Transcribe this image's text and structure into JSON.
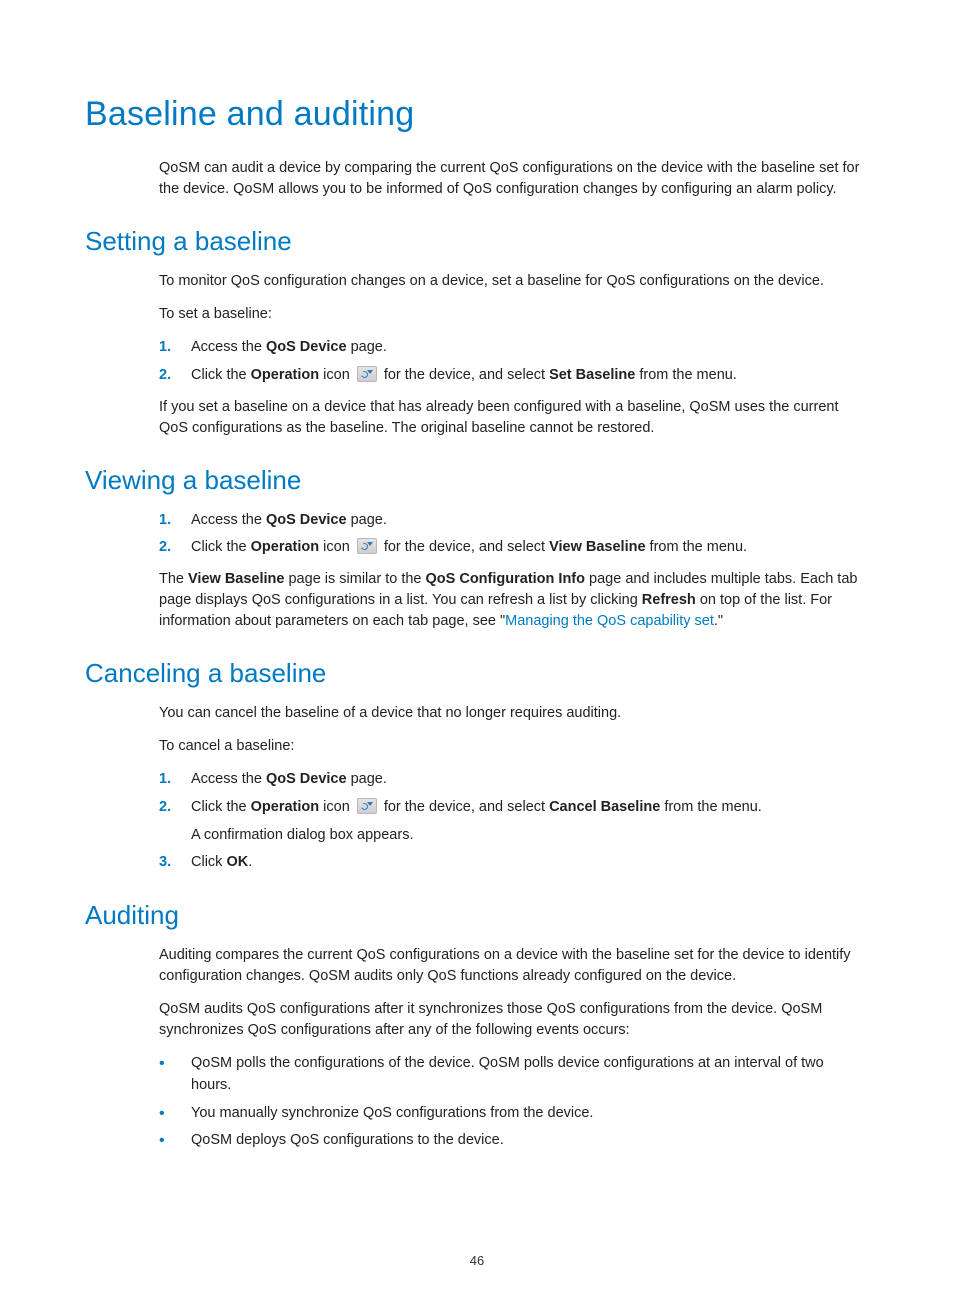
{
  "title": "Baseline and auditing",
  "intro": "QoSM can audit a device by comparing the current QoS configurations on the device with the baseline set for the device. QoSM allows you to be informed of QoS configuration changes by configuring an alarm policy.",
  "setting": {
    "heading": "Setting a baseline",
    "p1": "To monitor QoS configuration changes on a device, set a baseline for QoS configurations on the device.",
    "p2": "To set a baseline:",
    "step1_a": "Access the ",
    "step1_b": "QoS Device",
    "step1_c": " page.",
    "step2_a": "Click the ",
    "step2_b": "Operation",
    "step2_c": " icon ",
    "step2_d": " for the device, and select ",
    "step2_e": "Set Baseline",
    "step2_f": " from the menu.",
    "note": "If you set a baseline on a device that has already been configured with a baseline, QoSM uses the current QoS configurations as the baseline. The original baseline cannot be restored."
  },
  "viewing": {
    "heading": "Viewing a baseline",
    "step1_a": "Access the ",
    "step1_b": "QoS Device",
    "step1_c": " page.",
    "step2_a": "Click the ",
    "step2_b": "Operation",
    "step2_c": " icon ",
    "step2_d": " for the device, and select ",
    "step2_e": "View Baseline",
    "step2_f": " from the menu.",
    "para_a": "The ",
    "para_b": "View Baseline",
    "para_c": " page is similar to the ",
    "para_d": "QoS Configuration Info",
    "para_e": " page and includes multiple tabs. Each tab page displays QoS configurations in a list. You can refresh a list by clicking ",
    "para_f": "Refresh",
    "para_g": " on top of the list. For information about parameters on each tab page, see \"",
    "link": "Managing the QoS capability set",
    "para_h": ".\""
  },
  "canceling": {
    "heading": "Canceling a baseline",
    "p1": "You can cancel the baseline of a device that no longer requires auditing.",
    "p2": "To cancel a baseline:",
    "step1_a": "Access the ",
    "step1_b": "QoS Device",
    "step1_c": " page.",
    "step2_a": "Click the ",
    "step2_b": "Operation",
    "step2_c": " icon ",
    "step2_d": " for the device, and select ",
    "step2_e": "Cancel Baseline",
    "step2_f": " from the menu.",
    "step2_sub": "A confirmation dialog box appears.",
    "step3_a": "Click ",
    "step3_b": "OK",
    "step3_c": "."
  },
  "auditing": {
    "heading": "Auditing",
    "p1": "Auditing compares the current QoS configurations on a device with the baseline set for the device to identify configuration changes. QoSM audits only QoS functions already configured on the device.",
    "p2": "QoSM audits QoS configurations after it synchronizes those QoS configurations from the device. QoSM synchronizes QoS configurations after any of the following events occurs:",
    "b1": "QoSM polls the configurations of the device. QoSM polls device configurations at an interval of two hours.",
    "b2": "You manually synchronize QoS configurations from the device.",
    "b3": "QoSM deploys QoS configurations to the device."
  },
  "nums": {
    "n1": "1.",
    "n2": "2.",
    "n3": "3."
  },
  "bullet": "•",
  "page_number": "46"
}
